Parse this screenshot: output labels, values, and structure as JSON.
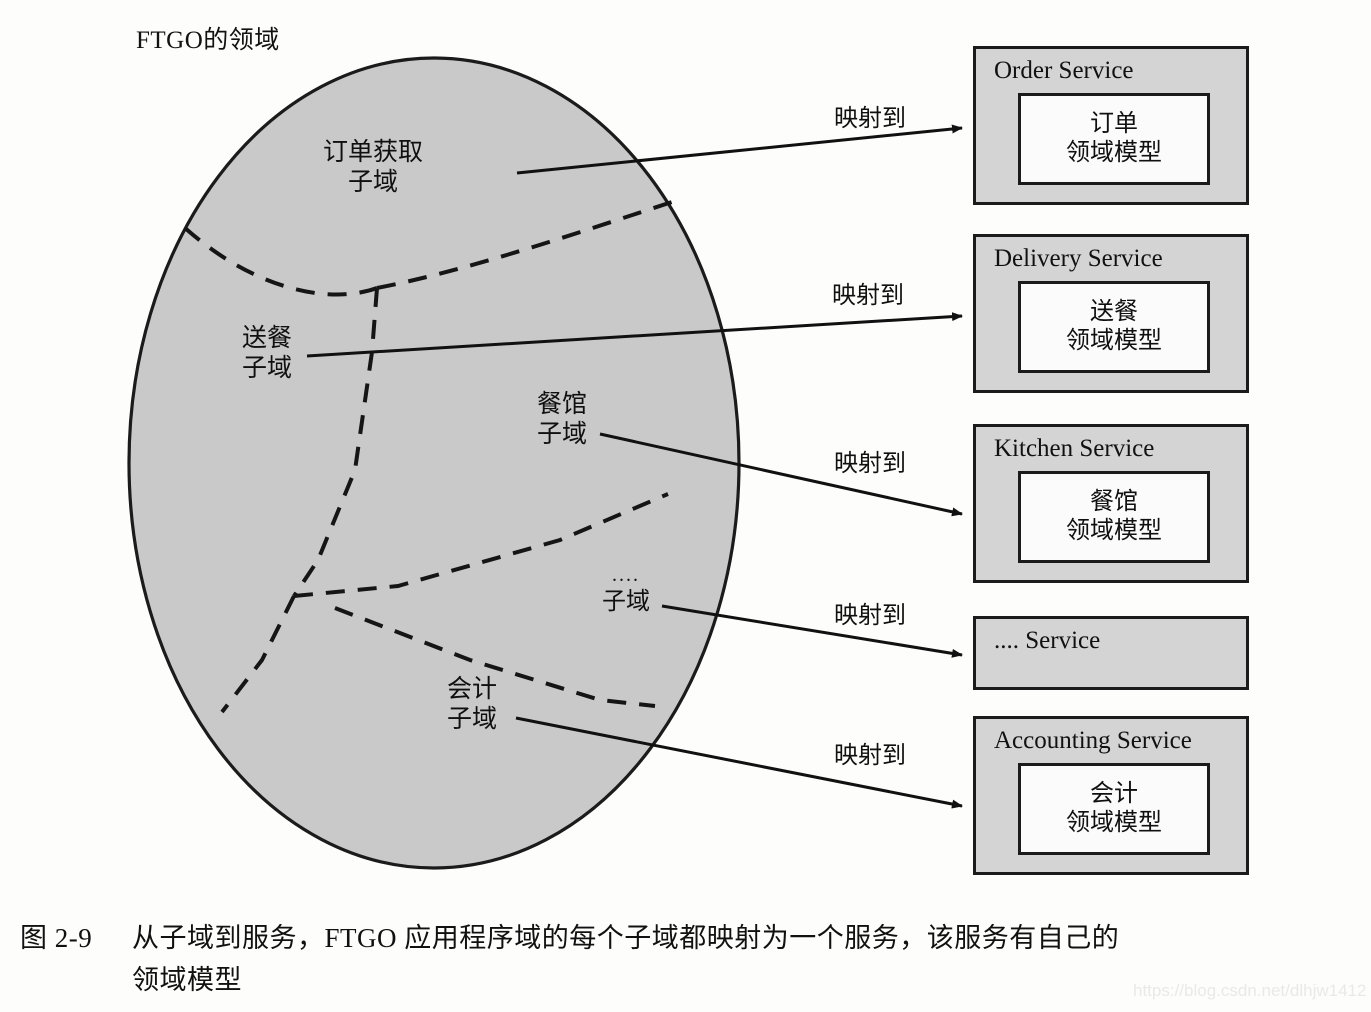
{
  "figure": {
    "domain_title": "FTGO的领域",
    "caption_number": "图 2-9",
    "caption_line1": "从子域到服务，FTGO 应用程序域的每个子域都映射为一个服务，该服务有自己的",
    "caption_line2": "领域模型",
    "watermark": "https://blog.csdn.net/dlhjw1412"
  },
  "colors": {
    "ellipse_fill": "#c9c9c9",
    "ellipse_stroke": "#1b1b1b",
    "service_fill": "#d4d4d4",
    "service_stroke": "#1b1b1b",
    "model_fill": "#fbfbfb",
    "arrow": "#111111",
    "partition_dash": "#151515"
  },
  "subdomains": [
    {
      "id": "order-taking",
      "line1": "订单获取",
      "line2": "子域"
    },
    {
      "id": "delivery",
      "line1": "送餐",
      "line2": "子域"
    },
    {
      "id": "restaurant",
      "line1": "餐馆",
      "line2": "子域"
    },
    {
      "id": "other",
      "line1": "....",
      "line2": "子域"
    },
    {
      "id": "accounting",
      "line1": "会计",
      "line2": "子域"
    }
  ],
  "mapping_labels": [
    {
      "id": "map-order",
      "text": "映射到"
    },
    {
      "id": "map-delivery",
      "text": "映射到"
    },
    {
      "id": "map-kitchen",
      "text": "映射到"
    },
    {
      "id": "map-other",
      "text": "映射到"
    },
    {
      "id": "map-accounting",
      "text": "映射到"
    }
  ],
  "services": [
    {
      "id": "order-service",
      "title": "Order Service",
      "has_model": true,
      "model_line1": "订单",
      "model_line2": "领域模型"
    },
    {
      "id": "delivery-service",
      "title": "Delivery Service",
      "has_model": true,
      "model_line1": "送餐",
      "model_line2": "领域模型"
    },
    {
      "id": "kitchen-service",
      "title": "Kitchen Service",
      "has_model": true,
      "model_line1": "餐馆",
      "model_line2": "领域模型"
    },
    {
      "id": "other-service",
      "title": ".... Service",
      "has_model": false,
      "model_line1": "",
      "model_line2": ""
    },
    {
      "id": "accounting-service",
      "title": "Accounting Service",
      "has_model": true,
      "model_line1": "会计",
      "model_line2": "领域模型"
    }
  ]
}
